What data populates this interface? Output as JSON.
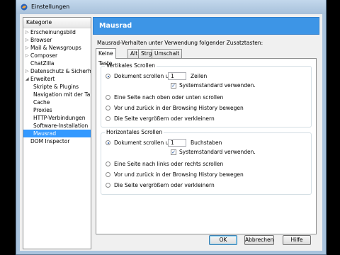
{
  "window": {
    "title": "Einstellungen"
  },
  "sidebar": {
    "header": "Kategorie",
    "items": [
      {
        "label": "Erscheinungsbild",
        "level": 0,
        "arrow": "▷"
      },
      {
        "label": "Browser",
        "level": 0,
        "arrow": "▷"
      },
      {
        "label": "Mail & Newsgroups",
        "level": 0,
        "arrow": "▷"
      },
      {
        "label": "Composer",
        "level": 0,
        "arrow": "▷"
      },
      {
        "label": "ChatZilla",
        "level": 0,
        "arrow": ""
      },
      {
        "label": "Datenschutz & Sicherheit",
        "level": 0,
        "arrow": "▷"
      },
      {
        "label": "Erweitert",
        "level": 0,
        "arrow": "◢"
      },
      {
        "label": "Skripte & Plugins",
        "level": 1,
        "arrow": ""
      },
      {
        "label": "Navigation mit der Ta...",
        "level": 1,
        "arrow": ""
      },
      {
        "label": "Cache",
        "level": 1,
        "arrow": ""
      },
      {
        "label": "Proxies",
        "level": 1,
        "arrow": ""
      },
      {
        "label": "HTTP-Verbindungen",
        "level": 1,
        "arrow": ""
      },
      {
        "label": "Software-Installation",
        "level": 1,
        "arrow": ""
      },
      {
        "label": "Mausrad",
        "level": 1,
        "arrow": "",
        "selected": true
      },
      {
        "label": "DOM Inspector",
        "level": 0,
        "arrow": ""
      }
    ]
  },
  "panel": {
    "title": "Mausrad",
    "description": "Mausrad-Verhalten unter Verwendung folgender Zusatztasten:",
    "tabs": [
      "Keine Taste",
      "Alt",
      "Strg",
      "Umschalt"
    ],
    "active_tab": "Keine Taste"
  },
  "vertical": {
    "legend": "Vertikales Scrollen",
    "scroll_label": "Dokument scrollen um",
    "scroll_value": "1",
    "unit": "Zeilen",
    "default_check": "Systemstandard verwenden.",
    "default_checked": true,
    "options": [
      "Eine Seite nach oben oder unten scrollen",
      "Vor und zurück in der Browsing History bewegen",
      "Die Seite vergrößern oder verkleinern"
    ]
  },
  "horizontal": {
    "legend": "Horizontales Scrollen",
    "scroll_label": "Dokument scrollen um",
    "scroll_value": "1",
    "unit": "Buchstaben",
    "default_check": "Systemstandard verwenden.",
    "default_checked": true,
    "options": [
      "Eine Seite nach links oder rechts scrollen",
      "Vor und zurück in der Browsing History bewegen",
      "Die Seite vergrößern oder verkleinern"
    ]
  },
  "buttons": {
    "ok": "OK",
    "cancel": "Abbrechen",
    "help": "Hilfe"
  },
  "colors": {
    "accent": "#3d95e6",
    "selection": "#3399ff"
  }
}
